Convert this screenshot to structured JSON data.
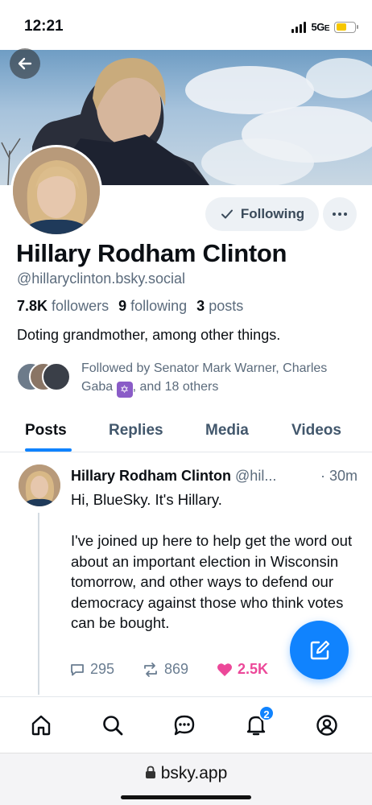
{
  "status_bar": {
    "time": "12:21",
    "network": "5G",
    "network_suffix": "E"
  },
  "profile": {
    "display_name": "Hillary Rodham Clinton",
    "handle": "@hillaryclinton.bsky.social",
    "followers_count": "7.8K",
    "followers_label": "followers",
    "following_count": "9",
    "following_label": "following",
    "posts_count": "3",
    "posts_label": "posts",
    "bio": "Doting grandmother, among other things.",
    "followed_by_prefix": "Followed by Senator Mark Warner, Charles Gaba",
    "followed_by_suffix": ", and 18 others"
  },
  "actions": {
    "following_label": "Following",
    "more_label": "···"
  },
  "tabs": [
    {
      "label": "Posts"
    },
    {
      "label": "Replies"
    },
    {
      "label": "Media"
    },
    {
      "label": "Videos"
    }
  ],
  "post": {
    "author": "Hillary Rodham Clinton",
    "handle": "@hil...",
    "time": "· 30m",
    "body": "Hi, BlueSky. It's Hillary.\n\nI've joined up here to help get the word out about an important election in Wisconsin tomorrow, and other ways to defend our democracy against those who think votes can be bought.",
    "replies": "295",
    "reposts": "869",
    "likes": "2.5K"
  },
  "nav": {
    "notifications_badge": "2"
  },
  "browser": {
    "url": "bsky.app"
  },
  "colors": {
    "accent": "#1083fe",
    "like": "#ec4899",
    "muted": "#5b6b7c"
  },
  "icons": [
    "back-arrow-icon",
    "check-icon",
    "more-icon",
    "reply-icon",
    "repost-icon",
    "heart-icon",
    "compose-icon",
    "home-icon",
    "search-icon",
    "chat-icon",
    "bell-icon",
    "profile-icon",
    "lock-icon"
  ]
}
